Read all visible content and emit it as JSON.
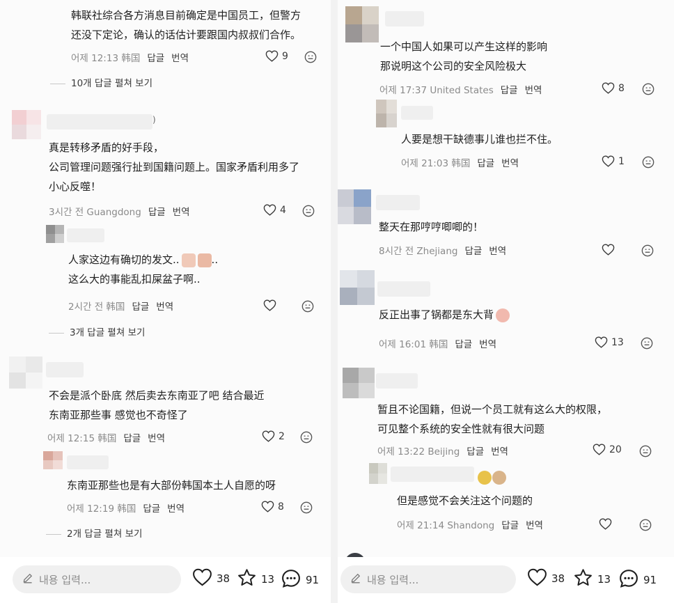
{
  "common": {
    "reply_label": "답글",
    "translate_label": "번역"
  },
  "left": {
    "top_comment": {
      "lines": [
        "韩联社综合各方消息目前确定是中国员工，但警方",
        "还没下定论，确认的话估计要跟国内叔叔们合作。"
      ],
      "meta": "어제 12:13 韩国",
      "likes": "9",
      "more_replies": "10개 답글 펼쳐 보기"
    },
    "comment_2": {
      "name_suffix": ")",
      "lines": [
        "真是转移矛盾的好手段，",
        "公司管理问题强行扯到国籍问题上。国家矛盾利用多了",
        "小心反噬！"
      ],
      "meta": "3시간 전 Guangdong",
      "likes": "4"
    },
    "reply_2a": {
      "lines": [
        "人家这边有确切的发文..",
        "这么大的事能乱扣屎盆子啊.."
      ],
      "line1_suffix": "..",
      "meta": "2시간 전 韩国",
      "likes": "",
      "more_replies": "3개 답글 펼쳐 보기"
    },
    "comment_3": {
      "lines": [
        "不会是派个卧底 然后卖去东南亚了吧 结合最近",
        "东南亚那些事 感觉也不奇怪了"
      ],
      "meta": "어제 12:15 韩国",
      "likes": "2"
    },
    "reply_3a": {
      "lines": [
        "东南亚那些也是有大部份韩国本土人自愿的呀"
      ],
      "meta": "어제 12:19 韩国",
      "likes": "8",
      "more_replies": "2개 답글 펼쳐 보기"
    },
    "bottom": {
      "placeholder": "내용 입력...",
      "likes": "38",
      "stars": "13",
      "comments": "91"
    }
  },
  "right": {
    "comment_1": {
      "lines": [
        "一个中国人如果可以产生这样的影响",
        "那说明这个公司的安全风险极大"
      ],
      "meta": "어제 17:37 United States",
      "likes": "8"
    },
    "reply_1a": {
      "lines": [
        "人要是想干缺德事儿谁也拦不住。"
      ],
      "meta": "어제 21:03 韩国",
      "likes": "1"
    },
    "comment_2": {
      "lines": [
        "整天在那哼哼唧唧的！"
      ],
      "meta": "8시간 전 Zhejiang",
      "likes": ""
    },
    "comment_3": {
      "lines": [
        "反正出事了锅都是东大背"
      ],
      "meta": "어제 16:01 韩国",
      "likes": "13"
    },
    "comment_4": {
      "lines": [
        "暂且不论国籍，但说一个员工就有这么大的权限，",
        "可见整个系统的安全性就有很大问题"
      ],
      "meta": "어제 13:22 Beijing",
      "likes": "20"
    },
    "reply_4a": {
      "lines": [
        "但是感觉不会关注这个问题的"
      ],
      "meta": "어제 21:14 Shandong",
      "likes": ""
    },
    "bottom": {
      "placeholder": "내용 입력...",
      "likes": "38",
      "stars": "13",
      "comments": "91"
    }
  },
  "colors": {
    "accent_text": "#1f1f1f",
    "muted": "#8a8a8a",
    "input_bg": "#f0f0f0"
  }
}
